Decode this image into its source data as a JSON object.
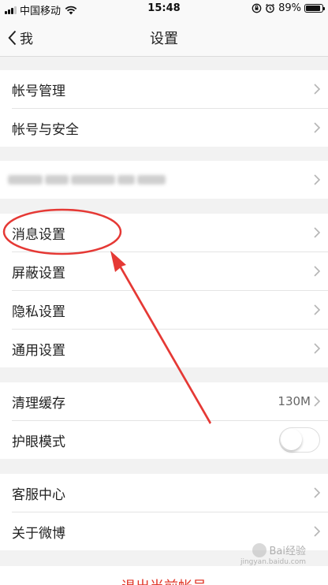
{
  "status_bar": {
    "carrier": "中国移动",
    "time": "15:48",
    "battery": "89%",
    "battery_level": 0.89
  },
  "nav": {
    "back_label": "我",
    "title": "设置"
  },
  "groups": {
    "account": [
      "帐号管理",
      "帐号与安全"
    ],
    "settings": [
      "消息设置",
      "屏蔽设置",
      "隐私设置",
      "通用设置"
    ],
    "cache_label": "清理缓存",
    "cache_size": "130M",
    "eye_mode_label": "护眼模式",
    "eye_mode_on": false,
    "support": [
      "客服中心",
      "关于微博"
    ]
  },
  "logout_label": "退出当前帐号",
  "watermark": {
    "text": "Bai经验",
    "sub": "jingyan.baidu.com"
  },
  "colors": {
    "annotation_red": "#e53935",
    "logout_red": "#e1392b"
  }
}
